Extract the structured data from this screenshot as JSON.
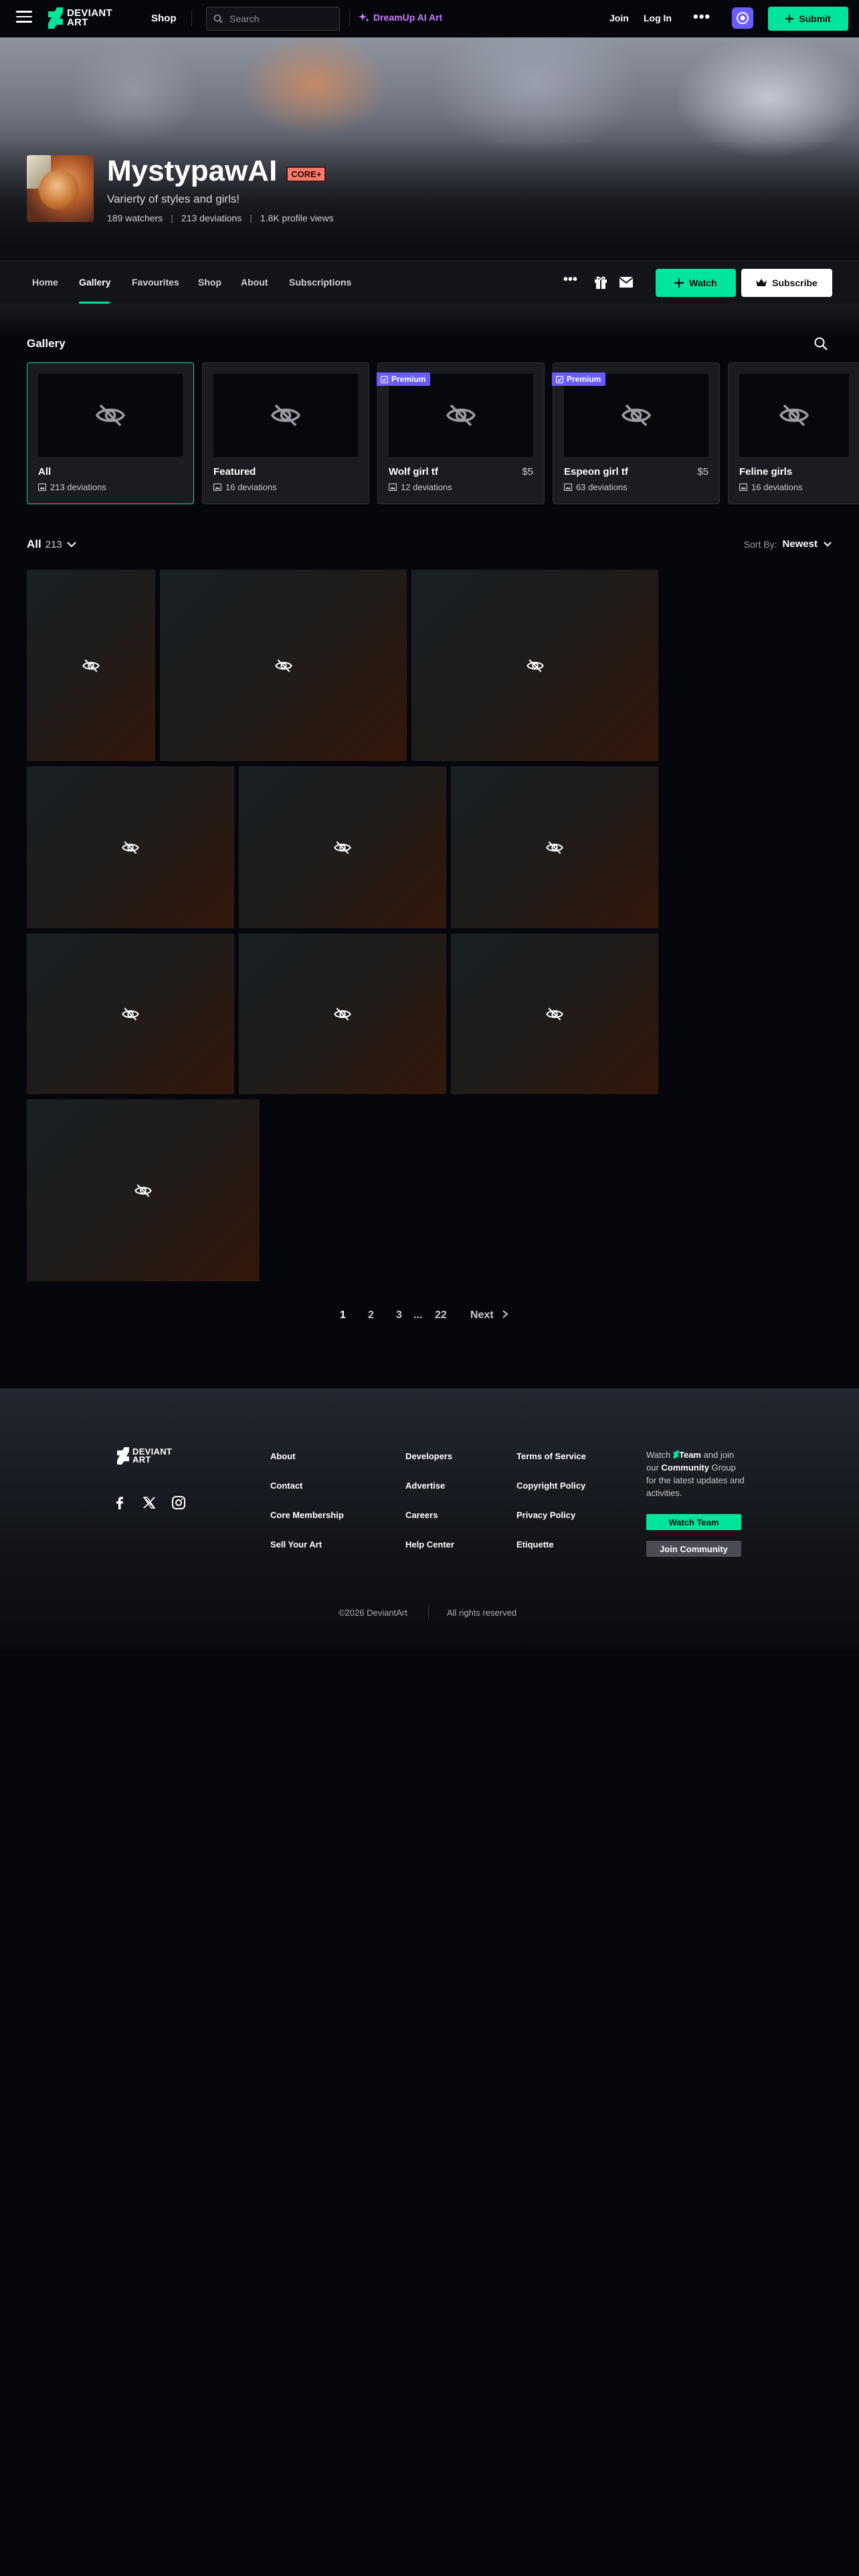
{
  "topbar": {
    "logo_line1": "DEVIANT",
    "logo_line2": "ART",
    "shop": "Shop",
    "search_placeholder": "Search",
    "dreamup": "DreamUp AI Art",
    "join": "Join",
    "login": "Log In",
    "more": "•••",
    "submit": "Submit"
  },
  "profile": {
    "username": "MystypawAI",
    "core_tag": "CORE+",
    "tagline": "Varierty of styles and girls!",
    "watchers": "189 watchers",
    "deviations": "213 deviations",
    "views": "1.8K profile views",
    "pipe": "|"
  },
  "profile_nav": {
    "tabs": [
      "Home",
      "Gallery",
      "Favourites",
      "Shop",
      "About",
      "Subscriptions"
    ],
    "active_tab": "Gallery",
    "more": "•••",
    "watch": "Watch",
    "subscribe": "Subscribe"
  },
  "gallery": {
    "title": "Gallery",
    "folders": [
      {
        "name": "All",
        "count": "213 deviations",
        "price": "",
        "premium": false,
        "active": true
      },
      {
        "name": "Featured",
        "count": "16 deviations",
        "price": "",
        "premium": false,
        "active": false
      },
      {
        "name": "Wolf girl tf",
        "count": "12 deviations",
        "price": "$5",
        "premium": true,
        "active": false
      },
      {
        "name": "Espeon girl tf",
        "count": "63 deviations",
        "price": "$5",
        "premium": true,
        "active": false
      },
      {
        "name": "Feline girls",
        "count": "16 deviations",
        "price": "",
        "premium": false,
        "active": false
      }
    ],
    "premium_label": "Premium",
    "filter_label": "All",
    "filter_count": "213",
    "sort_label": "Sort By:",
    "sort_value": "Newest",
    "tile_count": 13
  },
  "pagination": {
    "pages": [
      "1",
      "2",
      "3"
    ],
    "ellipsis": "...",
    "last": "22",
    "next": "Next",
    "current": "1"
  },
  "footer": {
    "logo_line1": "DEVIANT",
    "logo_line2": "ART",
    "col1": [
      "About",
      "Contact",
      "Core Membership",
      "Sell Your Art"
    ],
    "col2": [
      "Developers",
      "Advertise",
      "Careers",
      "Help Center"
    ],
    "col3": [
      "Terms of Service",
      "Copyright Policy",
      "Privacy Policy",
      "Etiquette"
    ],
    "blurb_watch": "Watch",
    "blurb_team": "Team",
    "blurb_and": "and join our",
    "blurb_community": "Community",
    "blurb_rest": "Group for the latest updates and activities.",
    "watch_team": "Watch Team",
    "join_community": "Join Community",
    "copyright": "©2026 DeviantArt",
    "rights": "All rights reserved"
  },
  "colors": {
    "accent": "#00e59b",
    "premium": "#6b5cff",
    "core": "#ff7a6b",
    "dreamup": "#c97dff"
  }
}
